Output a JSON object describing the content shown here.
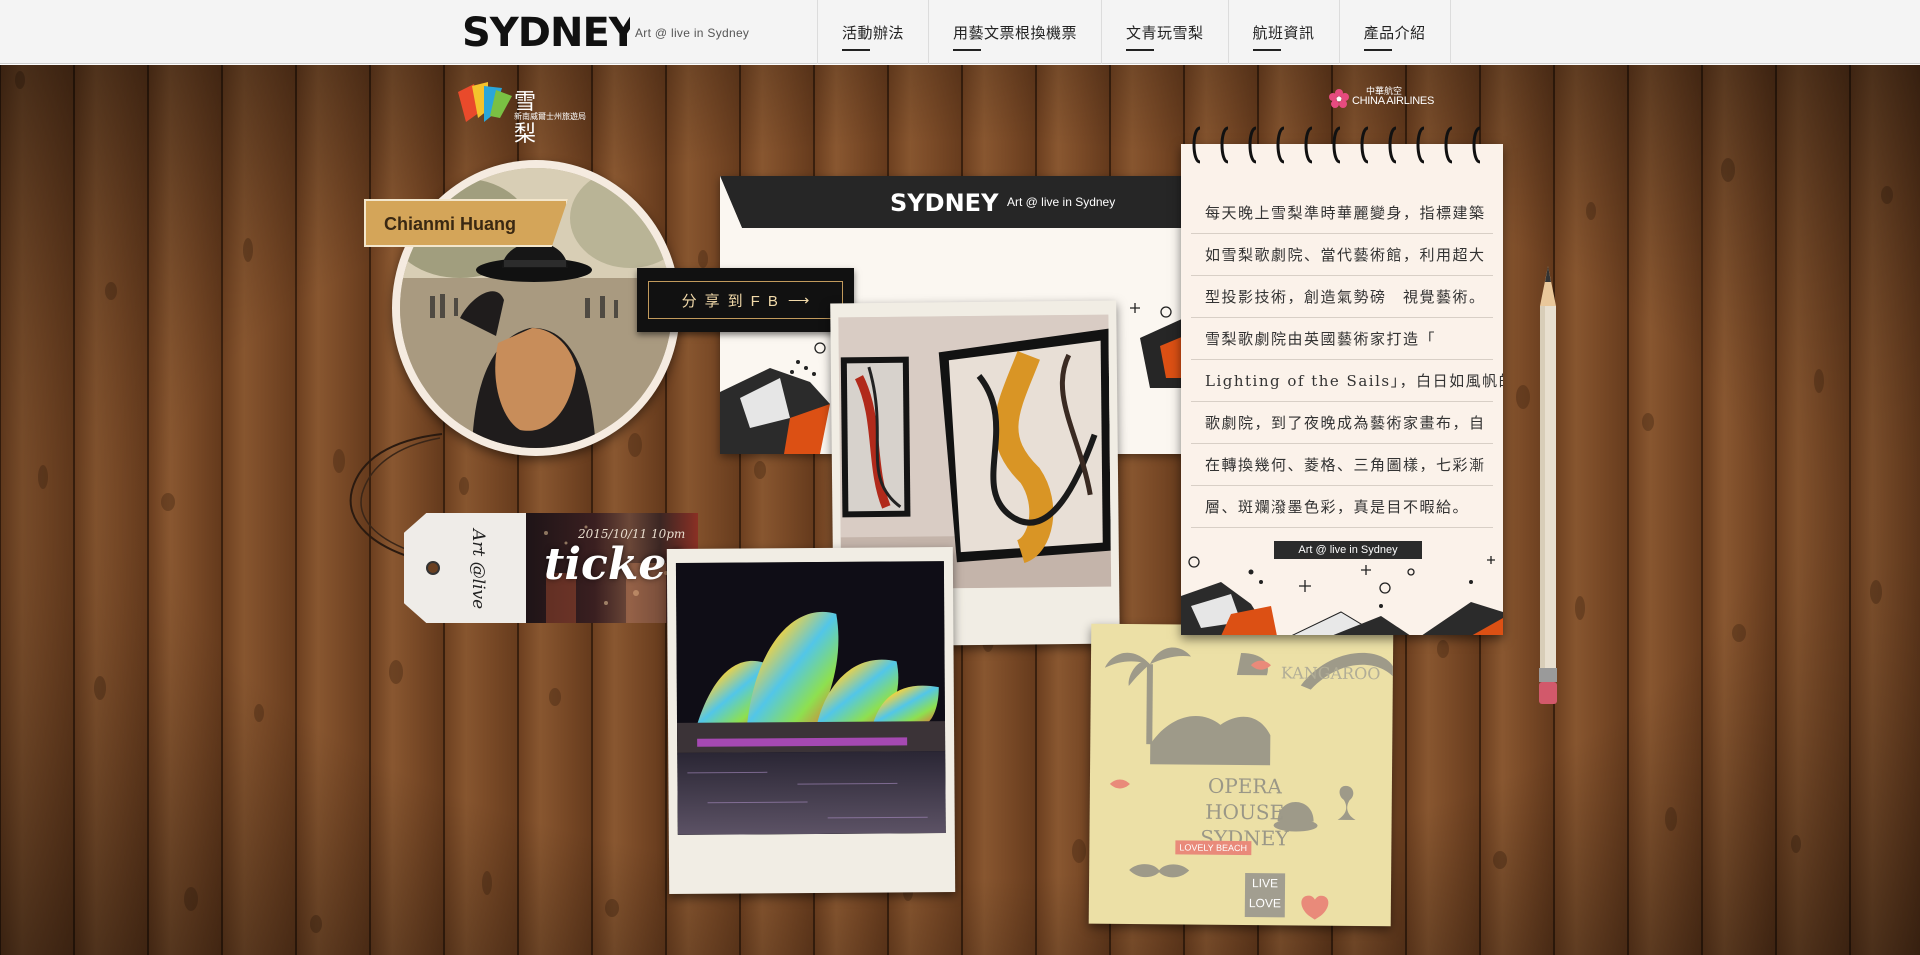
{
  "header": {
    "logo_text": "SYDNEY",
    "tagline": "Art @ live in Sydney",
    "nav": [
      {
        "label": "活動辦法"
      },
      {
        "label": "用藝文票根換機票"
      },
      {
        "label": "文青玩雪梨"
      },
      {
        "label": "航班資訊"
      },
      {
        "label": "產品介紹"
      }
    ]
  },
  "sponsors": {
    "vivid": {
      "title": "雪梨",
      "subtitle": "新南威爾士州旅遊局"
    },
    "airline": {
      "name_cn": "中華航空",
      "name_en": "CHINA AIRLINES"
    }
  },
  "profile": {
    "name": "Chianmi Huang"
  },
  "share": {
    "label": "分享到FB"
  },
  "ticket": {
    "tag_text": "Art @live",
    "date": "2015/10/11 10pm",
    "word": "ticket"
  },
  "card": {
    "logo_text": "SYDNEY",
    "tagline": "Art @ live in Sydney"
  },
  "notebook": {
    "lines": [
      "每天晚上雪梨準時華麗變身，指標建築",
      "如雪梨歌劇院、當代藝術館，利用超大",
      "型投影技術，創造氣勢磅　視覺藝術。",
      "雪梨歌劇院由英國藝術家打造「",
      "Lighting of the Sails」，白日如風帆的",
      "歌劇院，到了夜晚成為藝術家畫布，自",
      "在轉換幾何、菱格、三角圖樣，七彩漸",
      "層、斑斕潑墨色彩，真是目不暇給。"
    ],
    "label": "Art @ live in Sydney"
  },
  "poster": {
    "title": "OPERA HOUSE SYDNEY",
    "kangaroo": "KANGAROO",
    "beach": "LOVELY BEACH",
    "live_love": "LIVE LOVE"
  },
  "colors": {
    "wood": "#7a4a26",
    "name_tag": "#d4a559",
    "share_bg": "#111111",
    "share_text": "#f1d9a9"
  }
}
